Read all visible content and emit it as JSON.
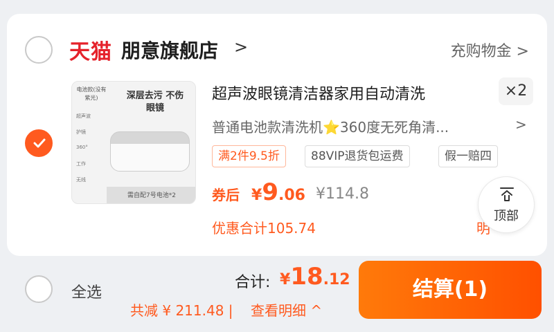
{
  "shop": {
    "brand": "天猫",
    "name": "朋意旗舰店",
    "arrow": ">",
    "coin_link": "充购物金 >"
  },
  "item": {
    "image": {
      "tag": "电池款(没有紫光)",
      "headline": "深层去污 不伤眼镜",
      "features": [
        "超声波",
        "护镜",
        "360°",
        "工作",
        "无线"
      ],
      "footer": "需自配7号电池*2"
    },
    "title": "超声波眼镜清洁器家用自动清洗",
    "quantity": "×2",
    "sku": "普通电池款清洗机⭐360度无死角清...",
    "sku_arrow": ">",
    "promos": [
      "满2件9.5折",
      "88VIP退货包运费",
      "假一赔四"
    ],
    "after_label": "券后",
    "after_price": {
      "symbol": "¥",
      "integer": "9",
      "decimal": ".06"
    },
    "original_price": "¥114.8",
    "discount_total": "优惠合计105.74",
    "detail_partial": "明"
  },
  "float_top": {
    "label": "顶部"
  },
  "footer": {
    "select_all": "全选",
    "total_label": "合计:",
    "total_price": {
      "symbol": "¥",
      "integer": "18",
      "decimal": ".12"
    },
    "saved": "共减 ¥ 211.48 |",
    "view_detail": "查看明细 ^",
    "checkout": "结算(1)"
  },
  "colors": {
    "accent": "#ff5a1f",
    "brand_red": "#e5222b",
    "checkout_start": "#ff7a0a",
    "checkout_end": "#ff5000"
  }
}
